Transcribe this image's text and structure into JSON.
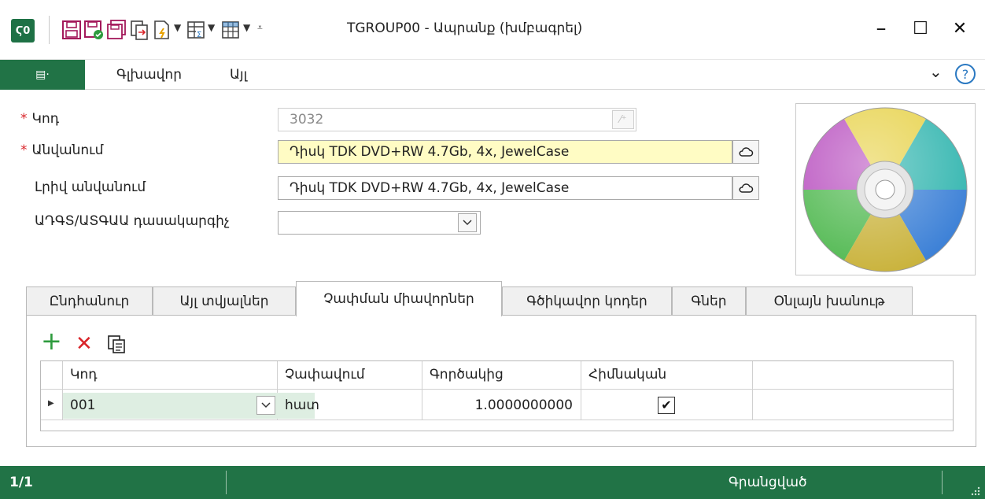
{
  "window": {
    "title": "TGROUP00 - Ապրանք (խմբագրել)",
    "logo_label": "Ϛ0",
    "controls": {
      "minimize": "–",
      "maximize": "☐",
      "close": "✕"
    }
  },
  "ribbon": {
    "file_glyph": "▤·",
    "tabs": [
      "Գլխավոր",
      "Այլ"
    ],
    "collapse_glyph": "⌄",
    "help_glyph": "?"
  },
  "form": {
    "code": {
      "label": "Կոդ",
      "value": "3032",
      "required": true
    },
    "name": {
      "label": "Անվանում",
      "value": "Դիսկ TDK DVD+RW 4.7Gb, 4x, JewelCase",
      "required": true
    },
    "full_name": {
      "label": "Լրիվ անվանում",
      "value": "Դիսկ TDK DVD+RW 4.7Gb, 4x, JewelCase"
    },
    "classifier": {
      "label": "ԱԴԳՏ/ԱՏԳԱԱ դասակարգիչ",
      "value": ""
    }
  },
  "tabs": [
    "Ընդհանուր",
    "Այլ տվյալներ",
    "Չափման միավորներ",
    "Գծիկավոր կոդեր",
    "Գներ",
    "Օնլայն խանութ"
  ],
  "active_tab": 2,
  "units_grid": {
    "columns": [
      "Կոդ",
      "Չափավում",
      "Գործակից",
      "Հիմնական"
    ],
    "rows": [
      {
        "code": "001",
        "measure": "հատ",
        "factor": "1.0000000000",
        "base": true
      }
    ],
    "row_marker": "▶",
    "check_glyph": "✔"
  },
  "toolbar": {
    "add_glyph": "+",
    "delete_glyph": "✕"
  },
  "status": {
    "records": "1/1",
    "state": "Գրանցված"
  },
  "colors": {
    "accent": "#217346",
    "required": "#d9252a",
    "highlight": "#fffcc4",
    "code_cell": "#deeee2"
  }
}
